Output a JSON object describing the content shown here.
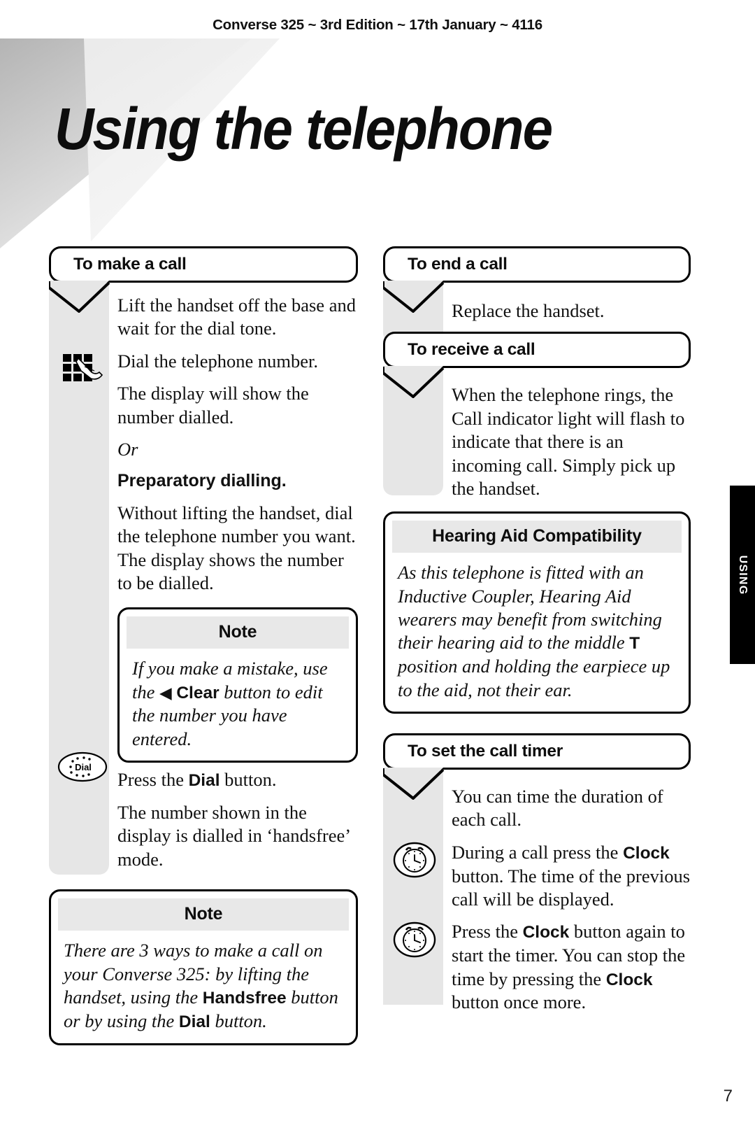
{
  "header": {
    "running_head": "Converse 325 ~ 3rd Edition ~ 17th January ~ 4116"
  },
  "title": "Using the telephone",
  "thumb_tab": {
    "label": "USING"
  },
  "page_number": "7",
  "left_column": {
    "section_make_call": {
      "heading": "To make a call",
      "paragraphs": [
        "Lift the handset off the base and wait for the dial tone.",
        "Dial the telephone number.",
        "The display will show the number dialled.",
        "Or",
        "Preparatory dialling.",
        "Without lifting the handset, dial the telephone number you want. The display shows the number to be dialled."
      ],
      "keypad_icon_name": "keypad-hand-icon",
      "note_1": {
        "title": "Note",
        "text_part_1": "If you make a mistake, use the ",
        "triangle_glyph": "◀",
        "bold_term": "Clear",
        "text_part_2": " button to edit the number you have entered."
      },
      "dial_icon": {
        "label": "Dial",
        "name": "dial-button-icon"
      },
      "after_dial_paragraphs": [
        {
          "pre": "Press the ",
          "bold": "Dial",
          "post": " button."
        },
        {
          "pre": "The number shown in the display is dialled in ‘handsfree’ mode.",
          "bold": "",
          "post": ""
        }
      ],
      "note_2": {
        "title": "Note",
        "text_part_1": "There are 3 ways to make a call on your Converse 325: by lifting the handset, using the ",
        "bold_term_1": "Handsfree",
        "text_part_2": " button or by using the ",
        "bold_term_2": "Dial",
        "text_part_3": " button."
      }
    }
  },
  "right_column": {
    "section_end_call": {
      "heading": "To end a call",
      "paragraphs": [
        "Replace the handset."
      ]
    },
    "section_receive_call": {
      "heading": "To receive a call",
      "paragraphs": [
        "When the telephone rings, the Call indicator light will flash to indicate that there is an incoming call. Simply pick up the handset."
      ]
    },
    "hearing_aid_box": {
      "title": "Hearing Aid Compatibility",
      "text_part_1": "As this telephone is fitted with an Inductive Coupler, Hearing Aid wearers may benefit from switching their hearing aid to the middle ",
      "bold_term": "T",
      "text_part_2": " position and holding the earpiece up to the aid, not their ear."
    },
    "section_call_timer": {
      "heading": "To set the call timer",
      "intro": "You can time the duration of each call.",
      "items": [
        {
          "icon_name": "clock-icon",
          "pre": "During a call press the ",
          "bold": "Clock",
          "post": " button. The time of the previous call will be displayed."
        },
        {
          "icon_name": "clock-icon",
          "pre": "Press the ",
          "bold": "Clock",
          "post": " button again to start the timer. You can stop the time by pressing the ",
          "bold2": "Clock",
          "post2": " button once more."
        }
      ]
    }
  },
  "colors": {
    "rail_gray": "#e6e6e6",
    "note_head_gray": "#e8e8e8",
    "tab_black": "#000000",
    "text_black": "#111111"
  }
}
